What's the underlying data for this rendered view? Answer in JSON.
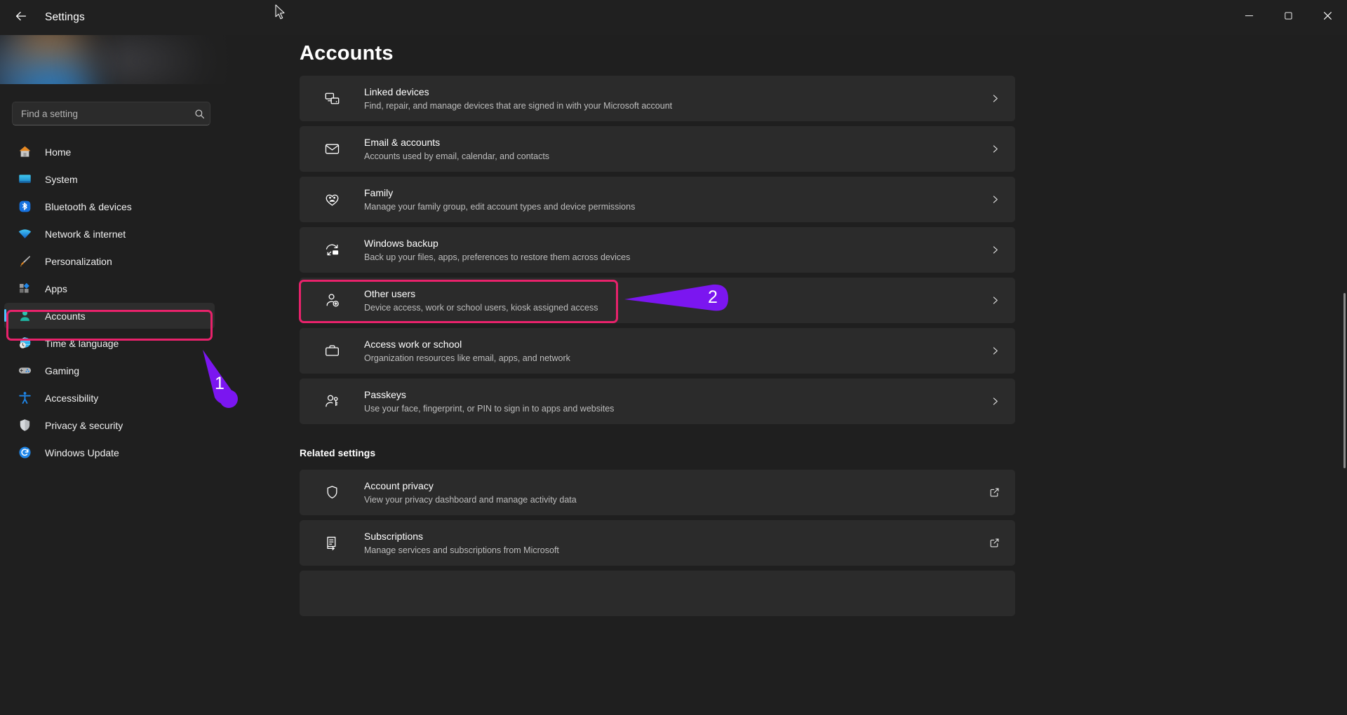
{
  "window": {
    "title": "Settings",
    "back_icon": "back-arrow-icon",
    "minimize_label": "Minimize",
    "maximize_label": "Maximize",
    "close_label": "Close"
  },
  "search": {
    "placeholder": "Find a setting",
    "value": "",
    "icon": "search-icon"
  },
  "sidebar": {
    "items": [
      {
        "label": "Home",
        "icon": "home-icon",
        "selected": false
      },
      {
        "label": "System",
        "icon": "system-icon",
        "selected": false
      },
      {
        "label": "Bluetooth & devices",
        "icon": "bluetooth-icon",
        "selected": false
      },
      {
        "label": "Network & internet",
        "icon": "wifi-icon",
        "selected": false
      },
      {
        "label": "Personalization",
        "icon": "paintbrush-icon",
        "selected": false
      },
      {
        "label": "Apps",
        "icon": "apps-icon",
        "selected": false
      },
      {
        "label": "Accounts",
        "icon": "accounts-icon",
        "selected": true
      },
      {
        "label": "Time & language",
        "icon": "clock-globe-icon",
        "selected": false
      },
      {
        "label": "Gaming",
        "icon": "gamepad-icon",
        "selected": false
      },
      {
        "label": "Accessibility",
        "icon": "accessibility-icon",
        "selected": false
      },
      {
        "label": "Privacy & security",
        "icon": "shield-icon",
        "selected": false
      },
      {
        "label": "Windows Update",
        "icon": "update-icon",
        "selected": false
      }
    ]
  },
  "main": {
    "page_title": "Accounts",
    "settings": [
      {
        "title": "Linked devices",
        "subtitle": "Find, repair, and manage devices that are signed in with your Microsoft account",
        "icon": "linked-devices-icon",
        "action_icon": "chevron-right-icon"
      },
      {
        "title": "Email & accounts",
        "subtitle": "Accounts used by email, calendar, and contacts",
        "icon": "envelope-icon",
        "action_icon": "chevron-right-icon"
      },
      {
        "title": "Family",
        "subtitle": "Manage your family group, edit account types and device permissions",
        "icon": "family-heart-icon",
        "action_icon": "chevron-right-icon"
      },
      {
        "title": "Windows backup",
        "subtitle": "Back up your files, apps, preferences to restore them across devices",
        "icon": "backup-icon",
        "action_icon": "chevron-right-icon"
      },
      {
        "title": "Other users",
        "subtitle": "Device access, work or school users, kiosk assigned access",
        "icon": "add-user-icon",
        "action_icon": "chevron-right-icon"
      },
      {
        "title": "Access work or school",
        "subtitle": "Organization resources like email, apps, and network",
        "icon": "briefcase-icon",
        "action_icon": "chevron-right-icon"
      },
      {
        "title": "Passkeys",
        "subtitle": "Use your face, fingerprint, or PIN to sign in to apps and websites",
        "icon": "passkey-icon",
        "action_icon": "chevron-right-icon"
      }
    ],
    "related_heading": "Related settings",
    "related": [
      {
        "title": "Account privacy",
        "subtitle": "View your privacy dashboard and manage activity data",
        "icon": "shield-outline-icon",
        "action_icon": "external-link-icon"
      },
      {
        "title": "Subscriptions",
        "subtitle": "Manage services and subscriptions from Microsoft",
        "icon": "subscriptions-icon",
        "action_icon": "external-link-icon"
      }
    ]
  },
  "annotations": {
    "box_color": "#e8226b",
    "arrow_color": "#7b16f0",
    "steps": [
      {
        "number": "1",
        "target": "Accounts"
      },
      {
        "number": "2",
        "target": "Other users"
      }
    ]
  }
}
